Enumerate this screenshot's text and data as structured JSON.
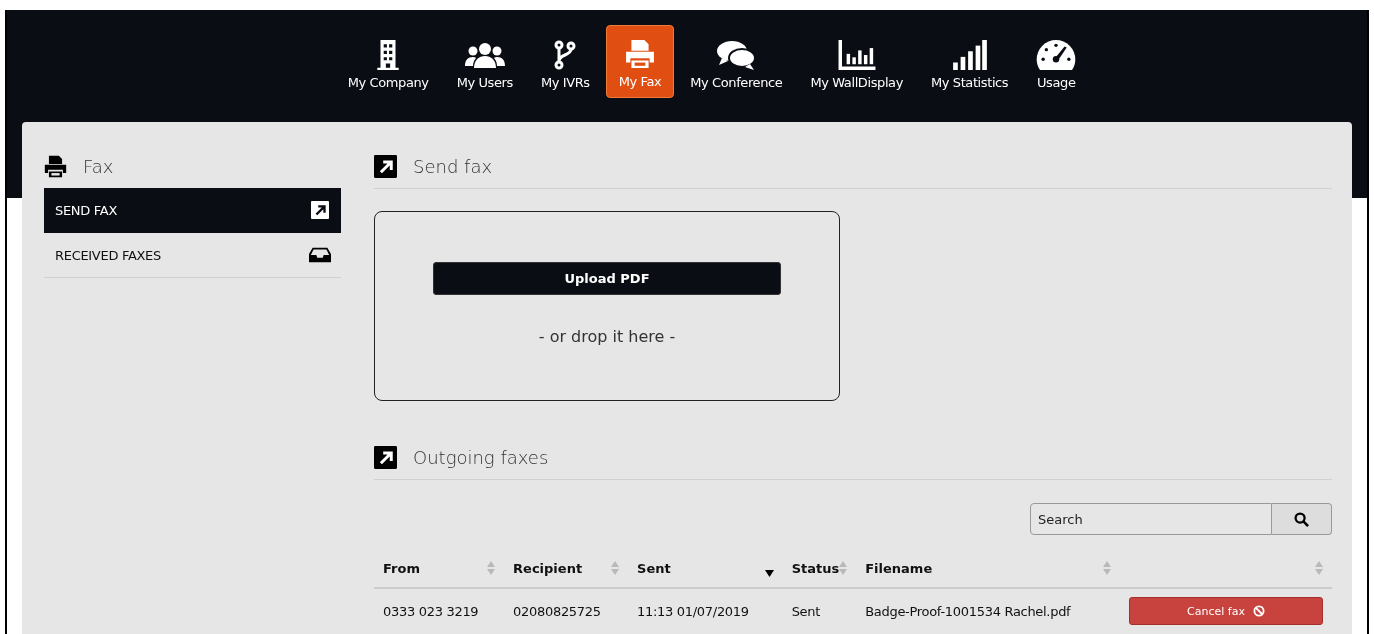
{
  "nav": [
    {
      "label": "My Company",
      "selected": false
    },
    {
      "label": "My Users",
      "selected": false
    },
    {
      "label": "My IVRs",
      "selected": false
    },
    {
      "label": "My Fax",
      "selected": true
    },
    {
      "label": "My Conference",
      "selected": false
    },
    {
      "label": "My WallDisplay",
      "selected": false
    },
    {
      "label": "My Statistics",
      "selected": false
    },
    {
      "label": "Usage",
      "selected": false
    }
  ],
  "sidebar": {
    "title": "Fax",
    "items": [
      {
        "label": "SEND FAX",
        "selected": true
      },
      {
        "label": "RECEIVED FAXES",
        "selected": false
      }
    ]
  },
  "send_section": {
    "title": "Send fax",
    "upload_button": "Upload PDF",
    "drop_hint": "- or drop it here -"
  },
  "outgoing_section": {
    "title": "Outgoing faxes",
    "search": {
      "placeholder": "Search"
    },
    "table": {
      "columns": [
        {
          "label": "From",
          "sorted_descending": false
        },
        {
          "label": "Recipient",
          "sorted_descending": false
        },
        {
          "label": "Sent",
          "sorted_descending": true
        },
        {
          "label": "Status",
          "sorted_descending": false
        },
        {
          "label": "Filename",
          "sorted_descending": false
        },
        {
          "sorted_descending": false
        }
      ],
      "rows": [
        {
          "cells": [
            "0333 023 3219",
            "02080825725",
            "11:13 01/07/2019",
            "Sent",
            "Badge-Proof-1001534 Rachel.pdf"
          ],
          "action": "Cancel fax"
        }
      ]
    }
  }
}
